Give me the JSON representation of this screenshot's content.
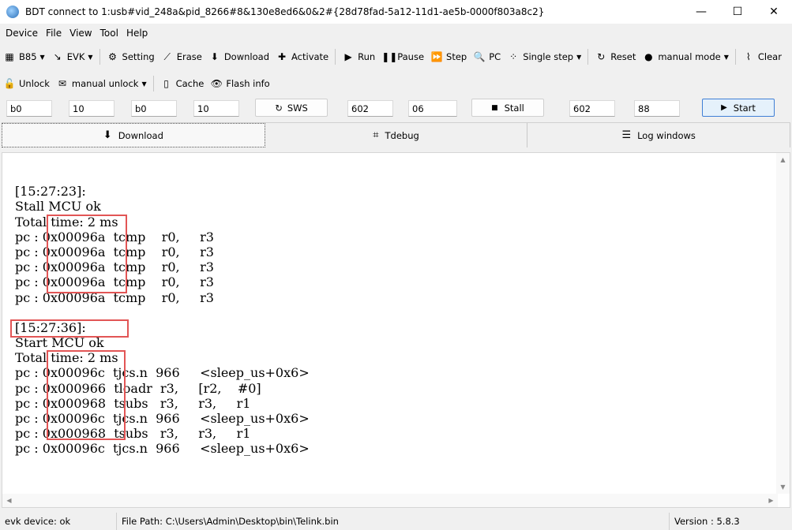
{
  "window": {
    "title": "BDT connect to 1:usb#vid_248a&pid_8266#8&130e8ed6&0&2#{28d78fad-5a12-11d1-ae5b-0000f803a8c2}",
    "minimize": "—",
    "maximize": "☐",
    "close": "✕"
  },
  "menu": [
    "Device",
    "File",
    "View",
    "Tool",
    "Help"
  ],
  "toolbar1": {
    "chip": "B85",
    "board": "EVK",
    "setting": "Setting",
    "erase": "Erase",
    "download": "Download",
    "activate": "Activate",
    "run": "Run",
    "pause": "Pause",
    "step": "Step",
    "pc": "PC",
    "single_step": "Single step",
    "reset": "Reset",
    "manual_mode": "manual mode",
    "clear": "Clear"
  },
  "toolbar2": {
    "unlock": "Unlock",
    "manual_unlock": "manual unlock",
    "cache": "Cache",
    "flash_info": "Flash info"
  },
  "params": {
    "f1": "b0",
    "f2": "10",
    "f3": "b0",
    "f4": "10",
    "sws": "SWS",
    "f5": "602",
    "f6": "06",
    "stall": "Stall",
    "f7": "602",
    "f8": "88",
    "start": "Start"
  },
  "tabs": {
    "download": "Download",
    "tdebug": "Tdebug",
    "log": "Log windows"
  },
  "log": [
    "",
    "[15:27:23]:",
    "Stall MCU ok",
    "Total time: 2 ms",
    "pc : 0x00096a  tcmp    r0,     r3",
    "pc : 0x00096a  tcmp    r0,     r3",
    "pc : 0x00096a  tcmp    r0,     r3",
    "pc : 0x00096a  tcmp    r0,     r3",
    "pc : 0x00096a  tcmp    r0,     r3",
    "",
    "[15:27:36]:",
    "Start MCU ok",
    "Total time: 2 ms",
    "pc : 0x00096c  tjcs.n  966     <sleep_us+0x6>",
    "pc : 0x000966  tloadr  r3,     [r2,    #0]",
    "pc : 0x000968  tsubs   r3,     r3,     r1",
    "pc : 0x00096c  tjcs.n  966     <sleep_us+0x6>",
    "pc : 0x000968  tsubs   r3,     r3,     r1",
    "pc : 0x00096c  tjcs.n  966     <sleep_us+0x6>"
  ],
  "status": {
    "device": "evk device: ok",
    "file_path": "File Path:  C:\\Users\\Admin\\Desktop\\bin\\Telink.bin",
    "version": "Version : 5.8.3"
  },
  "colors": {
    "highlight": "#e25555",
    "start_border": "#3f7fd6"
  }
}
